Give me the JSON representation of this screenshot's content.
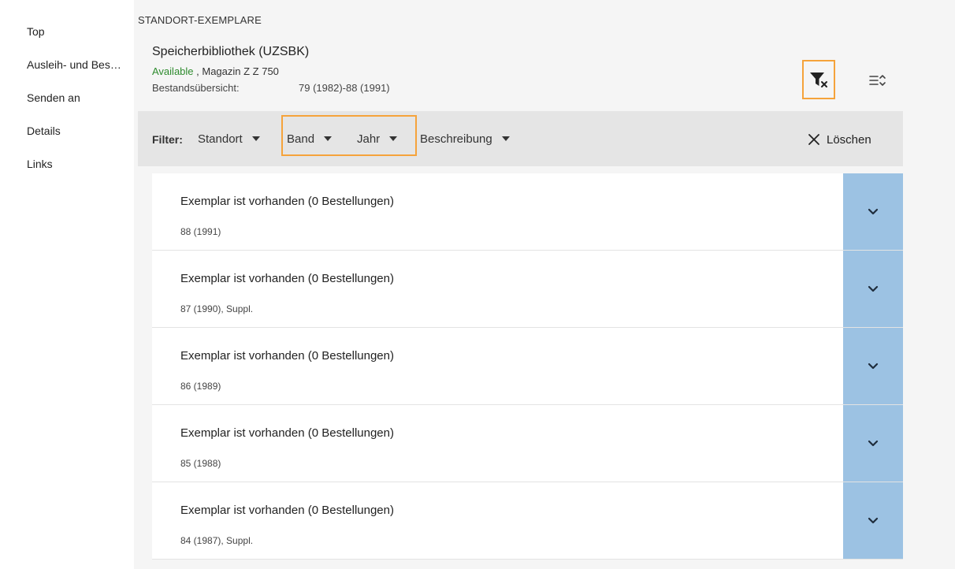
{
  "sidebar": {
    "items": [
      {
        "label": "Top"
      },
      {
        "label": "Ausleih- und Bes…"
      },
      {
        "label": "Senden an"
      },
      {
        "label": "Details"
      },
      {
        "label": "Links"
      }
    ]
  },
  "section": {
    "label": "STANDORT-EXEMPLARE"
  },
  "location": {
    "library": "Speicherbibliothek (UZSBK)",
    "availability": "Available",
    "location_suffix": " , Magazin Z Z 750",
    "holdings_label": "Bestandsübersicht:",
    "holdings_value": "79 (1982)-88 (1991)"
  },
  "filter": {
    "label": "Filter:",
    "dropdowns": [
      {
        "label": "Standort"
      },
      {
        "label": "Band"
      },
      {
        "label": "Jahr"
      },
      {
        "label": "Beschreibung"
      }
    ],
    "clear_label": "Löschen"
  },
  "items": [
    {
      "status": "Exemplar ist vorhanden (0 Bestellungen)",
      "description": "88 (1991)"
    },
    {
      "status": "Exemplar ist vorhanden (0 Bestellungen)",
      "description": "87 (1990), Suppl."
    },
    {
      "status": "Exemplar ist vorhanden (0 Bestellungen)",
      "description": "86 (1989)"
    },
    {
      "status": "Exemplar ist vorhanden (0 Bestellungen)",
      "description": "85 (1988)"
    },
    {
      "status": "Exemplar ist vorhanden (0 Bestellungen)",
      "description": "84 (1987), Suppl."
    }
  ],
  "icons": {
    "filter_clear": "filter-clear-icon",
    "sort": "sort-icon",
    "clear": "close-icon",
    "expand": "chevron-down-icon"
  },
  "colors": {
    "available": "#2e8b2e",
    "highlight": "#f5a33b",
    "expand_button": "#9cc2e3"
  }
}
